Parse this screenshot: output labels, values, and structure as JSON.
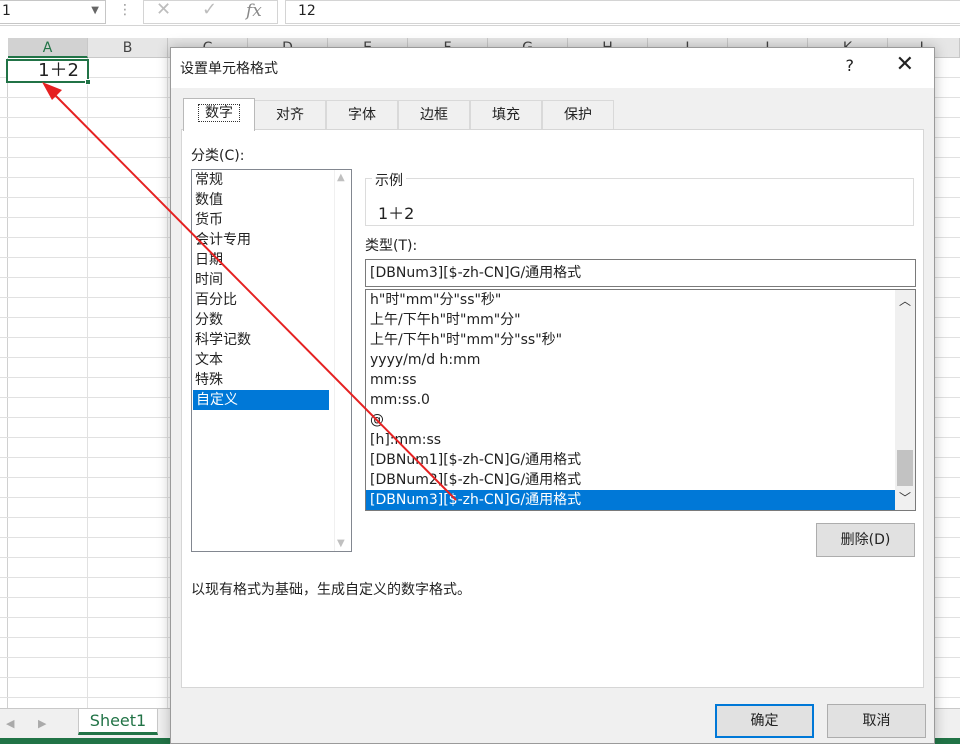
{
  "formula_bar": {
    "name_box": "1",
    "cancel_glyph": "✕",
    "enter_glyph": "✓",
    "fx_glyph": "fx",
    "content": "12"
  },
  "grid": {
    "columns": [
      "A",
      "B",
      "C",
      "D",
      "E",
      "F",
      "G",
      "H",
      "I",
      "J",
      "K",
      "L"
    ],
    "selected_cell_value": "1＋2"
  },
  "sheet": {
    "tab_label": "Sheet1"
  },
  "dialog": {
    "title": "设置单元格格式",
    "help": "?",
    "close": "✕",
    "tabs": [
      "数字",
      "对齐",
      "字体",
      "边框",
      "填充",
      "保护"
    ],
    "category_label": "分类(C):",
    "categories": [
      "常规",
      "数值",
      "货币",
      "会计专用",
      "日期",
      "时间",
      "百分比",
      "分数",
      "科学记数",
      "文本",
      "特殊",
      "自定义"
    ],
    "selected_category": "自定义",
    "sample_label": "示例",
    "sample_value": "1＋2",
    "type_label": "类型(T):",
    "type_value": "[DBNum3][$-zh-CN]G/通用格式",
    "formats": [
      "h\"时\"mm\"分\"ss\"秒\"",
      "上午/下午h\"时\"mm\"分\"",
      "上午/下午h\"时\"mm\"分\"ss\"秒\"",
      "yyyy/m/d h:mm",
      "mm:ss",
      "mm:ss.0",
      "@",
      "[h]:mm:ss",
      "[DBNum1][$-zh-CN]G/通用格式",
      "[DBNum2][$-zh-CN]G/通用格式",
      "[DBNum3][$-zh-CN]G/通用格式"
    ],
    "delete_button": "删除(D)",
    "description": "以现有格式为基础，生成自定义的数字格式。",
    "ok_button": "确定",
    "cancel_button": "取消"
  },
  "colors": {
    "excel_green": "#217346",
    "selection_blue": "#0078d7",
    "annotation_red": "#e52121"
  }
}
